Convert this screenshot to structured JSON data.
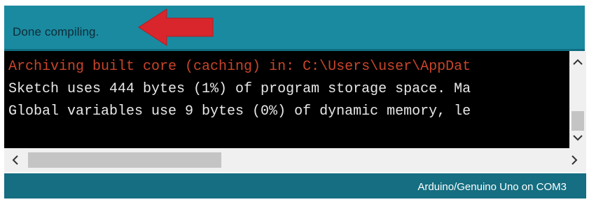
{
  "status": {
    "message": "Done compiling."
  },
  "annotation": {
    "arrow_color": "#d8262c",
    "arrow_icon": "left-arrow-icon"
  },
  "console": {
    "lines": [
      "Archiving built core (caching) in: C:\\Users\\user\\AppDat",
      "Sketch uses 444 bytes (1%) of program storage space. Ma",
      "Global variables use 9 bytes (0%) of dynamic memory, le"
    ],
    "error_color": "#c8452a",
    "text_color": "#e8e8e8"
  },
  "scrollbars": {
    "vertical_up_icon": "chevron-up-icon",
    "vertical_down_icon": "chevron-down-icon",
    "horizontal_left_icon": "chevron-left-icon",
    "horizontal_right_icon": "chevron-right-icon"
  },
  "footer": {
    "board": "Arduino/Genuino Uno on COM3"
  },
  "colors": {
    "status_bar": "#1a8aa0",
    "footer": "#156e81",
    "console_bg": "#000000"
  }
}
